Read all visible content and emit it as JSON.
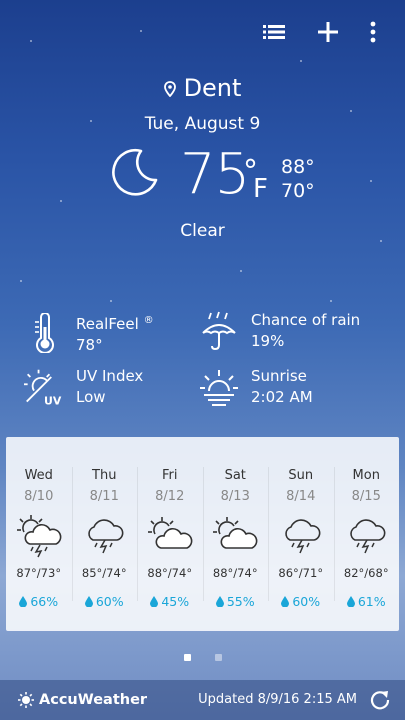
{
  "toolbar": {
    "list_icon": "list-icon",
    "add_icon": "plus-icon",
    "menu_icon": "more-vert-icon"
  },
  "location": {
    "name": "Dent",
    "icon": "location-pin-icon"
  },
  "date": "Tue, August 9",
  "current": {
    "icon": "moon-icon",
    "temp": "75",
    "deg": "°",
    "unit": "F",
    "high": "88°",
    "low": "70°",
    "condition": "Clear"
  },
  "details": {
    "realfeel": {
      "label": "RealFeel",
      "reg": "®",
      "value": "78°",
      "icon": "thermometer-icon"
    },
    "rain": {
      "label": "Chance of rain",
      "value": "19%",
      "icon": "umbrella-rain-icon"
    },
    "uv": {
      "label": "UV Index",
      "value": "Low",
      "icon": "uv-sun-icon",
      "badge": "UV"
    },
    "sunrise": {
      "label": "Sunrise",
      "value": "2:02 AM",
      "icon": "sunrise-icon"
    }
  },
  "forecast": [
    {
      "day": "Wed",
      "date": "8/10",
      "icon": "partly-sunny-thunderstorm-icon",
      "temps": "87°/73°",
      "precip": "66%"
    },
    {
      "day": "Thu",
      "date": "8/11",
      "icon": "thunderstorm-icon",
      "temps": "85°/74°",
      "precip": "60%"
    },
    {
      "day": "Fri",
      "date": "8/12",
      "icon": "partly-sunny-icon",
      "temps": "88°/74°",
      "precip": "45%"
    },
    {
      "day": "Sat",
      "date": "8/13",
      "icon": "partly-sunny-icon",
      "temps": "88°/74°",
      "precip": "55%"
    },
    {
      "day": "Sun",
      "date": "8/14",
      "icon": "thunderstorm-icon",
      "temps": "86°/71°",
      "precip": "60%"
    },
    {
      "day": "Mon",
      "date": "8/15",
      "icon": "thunderstorm-icon",
      "temps": "82°/68°",
      "precip": "61%"
    }
  ],
  "pager": {
    "pages": 2,
    "active": 1
  },
  "footer": {
    "brand": "AccuWeather",
    "updated": "Updated 8/9/16 2:15 AM",
    "refresh_icon": "refresh-icon"
  },
  "colors": {
    "precip": "#1aa6d8",
    "panel": "#ffffff"
  }
}
